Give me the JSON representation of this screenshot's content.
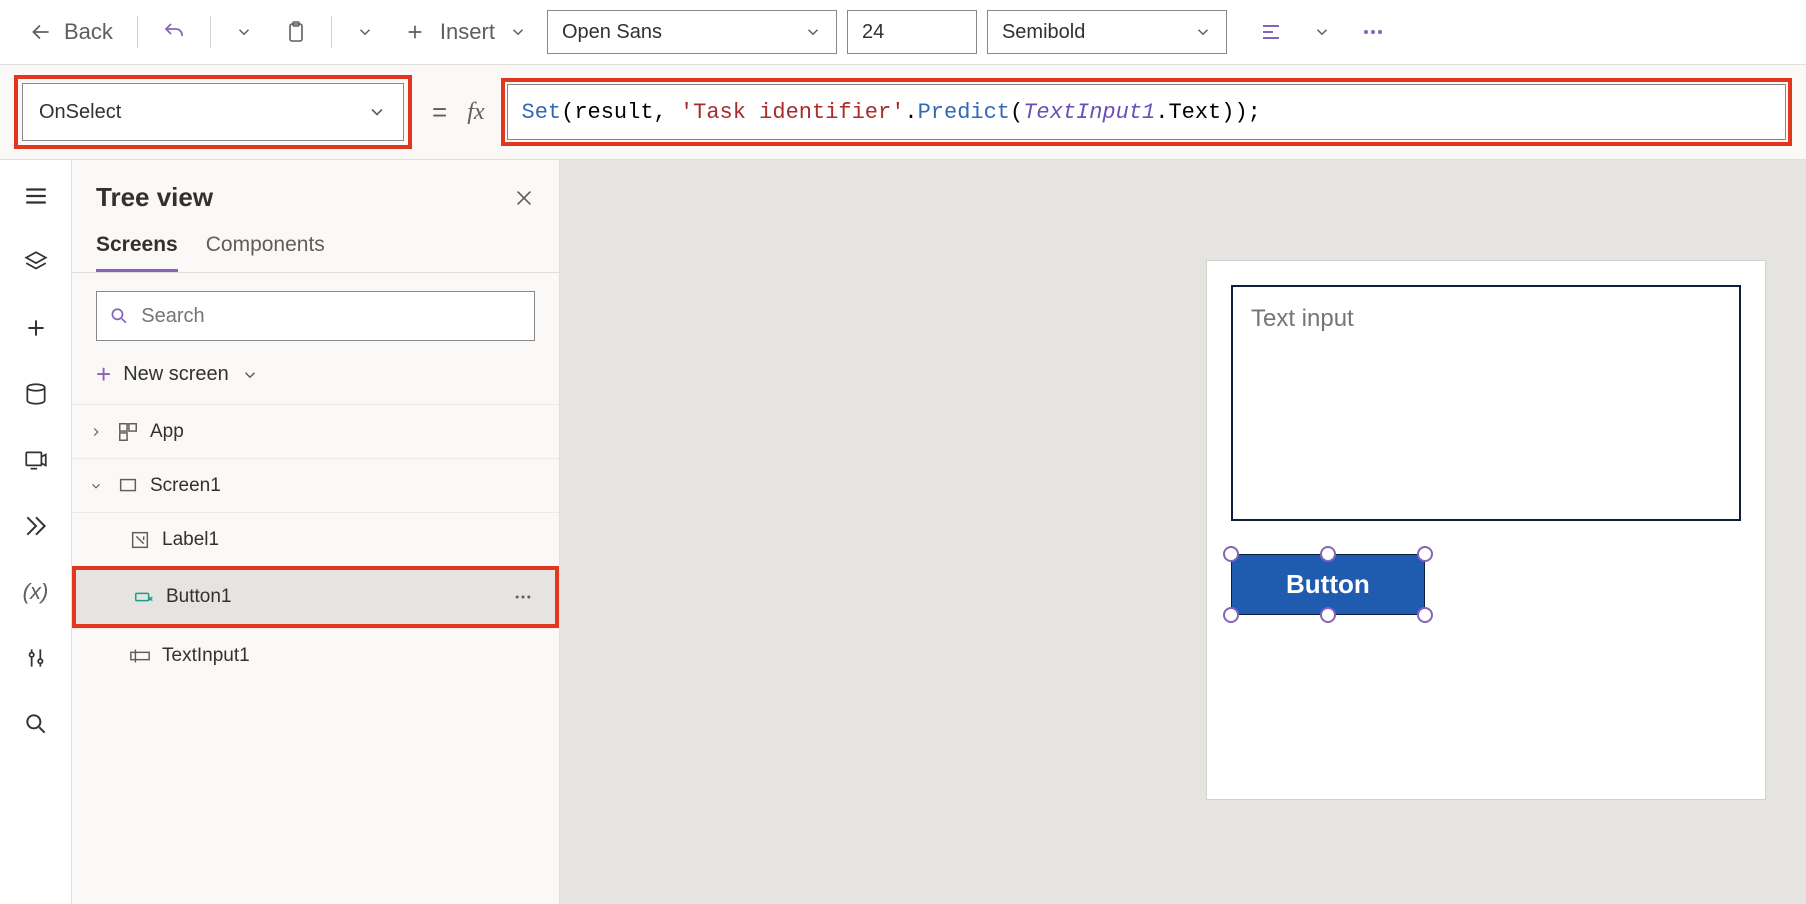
{
  "toolbar": {
    "back_label": "Back",
    "insert_label": "Insert",
    "font_family": "Open Sans",
    "font_size": "24",
    "font_weight": "Semibold"
  },
  "formula_bar": {
    "property": "OnSelect",
    "tokens": {
      "set": "Set",
      "open": "(result, ",
      "str": "'Task identifier'",
      "dot": ".",
      "predict": "Predict",
      "open2": "(",
      "prop": "TextInput1",
      "dot2": ".Text));"
    }
  },
  "tree": {
    "title": "Tree view",
    "tabs": {
      "screens": "Screens",
      "components": "Components"
    },
    "search_placeholder": "Search",
    "new_screen": "New screen",
    "app": "App",
    "screen1": "Screen1",
    "label1": "Label1",
    "button1": "Button1",
    "textinput1": "TextInput1"
  },
  "canvas": {
    "text_input_placeholder": "Text input",
    "button_label": "Button"
  }
}
